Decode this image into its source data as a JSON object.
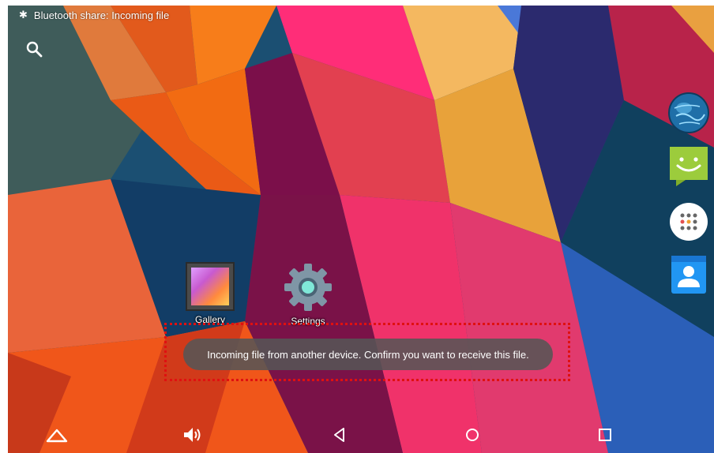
{
  "status_bar": {
    "bluetooth_icon": "bluetooth-icon",
    "notification_text": "Bluetooth share: Incoming file"
  },
  "search": {
    "icon": "search-icon"
  },
  "apps": [
    {
      "label": "Gallery",
      "icon": "gallery-icon"
    },
    {
      "label": "Settings",
      "icon": "gear-icon"
    }
  ],
  "toast": {
    "message": "Incoming file from another device. Confirm you want to receive this file.",
    "highlight_color": "#e01010"
  },
  "dock": [
    {
      "icon": "browser-globe-icon"
    },
    {
      "icon": "messaging-icon"
    },
    {
      "icon": "app-drawer-icon"
    },
    {
      "icon": "contacts-icon"
    }
  ],
  "nav_bar": {
    "icons": [
      "up-arrow-icon",
      "volume-icon",
      "back-icon",
      "home-icon",
      "recent-apps-icon"
    ]
  },
  "colors": {
    "toast_bg": "#555555",
    "messaging_green": "#9ccc3c",
    "contacts_blue": "#2196f3"
  }
}
